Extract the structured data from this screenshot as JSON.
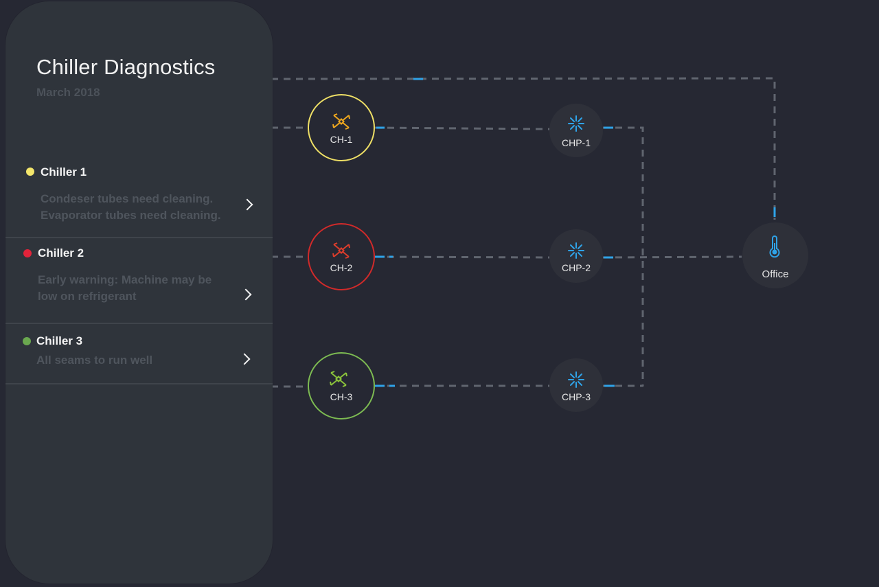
{
  "panel": {
    "title": "Chiller Diagnostics",
    "subtitle": "March 2018"
  },
  "chillers": [
    {
      "name": "Chiller 1",
      "status_color": "#f3e66b",
      "message_lines": [
        "Condeser tubes need cleaning.",
        "Evaporator tubes need cleaning."
      ]
    },
    {
      "name": "Chiller 2",
      "status_color": "#e2233a",
      "message_lines": [
        "Early warning: Machine may be",
        "low on refrigerant"
      ]
    },
    {
      "name": "Chiller 3",
      "status_color": "#6aa84f",
      "message_lines": [
        "All seams to run well"
      ]
    }
  ],
  "diagram": {
    "chiller_nodes": [
      {
        "label": "CH-1",
        "ring_color": "#efe066",
        "icon": "fan-icon",
        "icon_color": "#f0a81e"
      },
      {
        "label": "CH-2",
        "ring_color": "#d12a2a",
        "icon": "fan-icon",
        "icon_color": "#dd3d2b"
      },
      {
        "label": "CH-3",
        "ring_color": "#7dbb52",
        "icon": "fan-icon",
        "icon_color": "#8cc43b"
      }
    ],
    "pump_nodes": [
      {
        "label": "CHP-1",
        "icon": "pump-icon"
      },
      {
        "label": "CHP-2",
        "icon": "pump-icon"
      },
      {
        "label": "CHP-3",
        "icon": "pump-icon"
      }
    ],
    "office_node": {
      "label": "Office",
      "icon": "thermometer-icon"
    },
    "colors": {
      "pipe": "#60656f",
      "flow": "#2fa3e8",
      "node_bg": "#2e3039",
      "label": "#e6e6e6"
    }
  }
}
